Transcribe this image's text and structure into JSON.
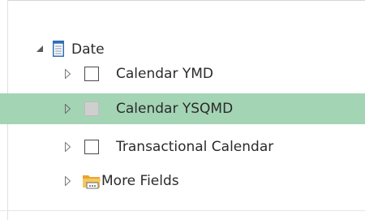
{
  "field_list": {
    "table": {
      "label": "Date",
      "expanded": true,
      "icon": "table-icon"
    },
    "fields": [
      {
        "label": "Calendar YMD",
        "checked": false,
        "selected": false,
        "icon": "checkbox"
      },
      {
        "label": "Calendar YSQMD",
        "checked": false,
        "selected": true,
        "icon": "checkbox"
      },
      {
        "label": "Transactional Calendar",
        "checked": false,
        "selected": false,
        "icon": "checkbox"
      }
    ],
    "more_fields": {
      "label": "More Fields",
      "icon": "folder-icon"
    },
    "colors": {
      "selected_row": "#a3d4b4",
      "text": "#2b2b2b",
      "folder": "#f0b43c",
      "table_icon": "#2f6fb7"
    }
  }
}
